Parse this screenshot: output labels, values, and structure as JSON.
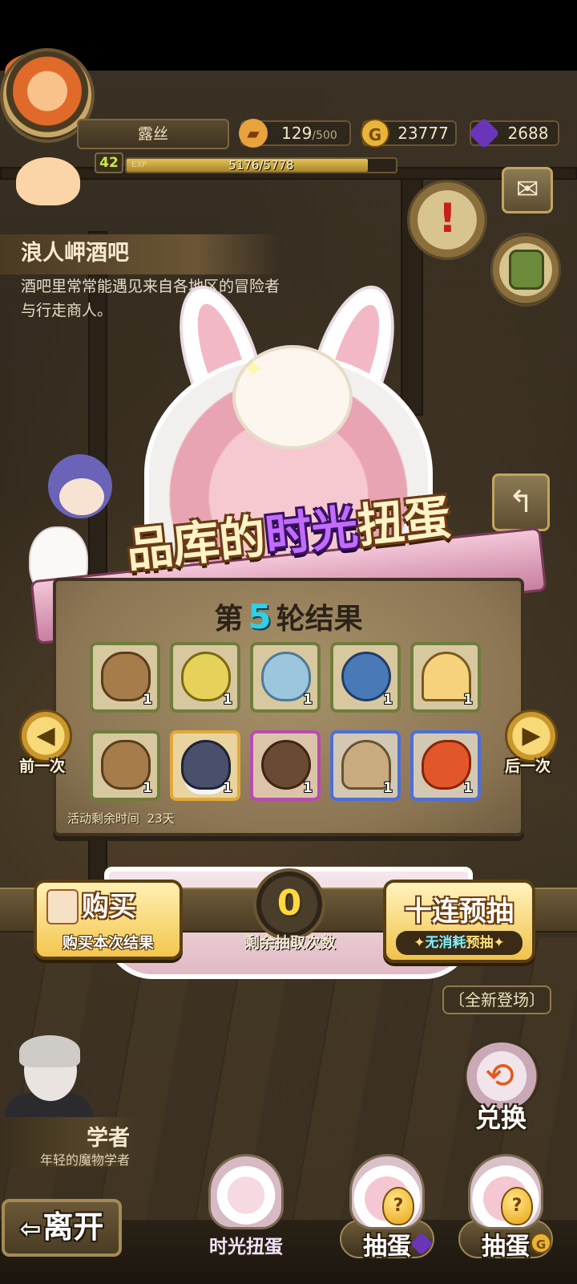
{
  "player": {
    "name": "露丝",
    "level": "42",
    "exp_label": "EXP",
    "exp_text": "5176/5778",
    "exp_progress": 0.896
  },
  "resources": {
    "stamina": {
      "icon": "bread-icon",
      "value": "129",
      "max": "/500"
    },
    "gold": {
      "icon": "gold-coin-icon",
      "glyph": "G",
      "value": "23777"
    },
    "gems": {
      "icon": "purple-gem-icon",
      "value": "2688"
    }
  },
  "location": {
    "title": "浪人岬酒吧",
    "description": "酒吧里常常能遇见来自各地区的冒险者与行走商人。"
  },
  "gacha": {
    "title_part1": "品库的",
    "title_highlight": "时光",
    "title_part2": "扭蛋",
    "round_prefix": "第",
    "round_number": "5",
    "round_suffix": "轮结果",
    "time_left_label": "活动剩余时间",
    "time_left_value": "23天",
    "prev_label": "前一次",
    "next_label": "后一次",
    "items": [
      {
        "name": "wooden-barrel-icon",
        "count": "1",
        "rarity": "green",
        "color": "#a57c4a"
      },
      {
        "name": "golden-egg-nest-icon",
        "count": "1",
        "rarity": "green",
        "color": "#e6d25a"
      },
      {
        "name": "blue-vase-icon",
        "count": "1",
        "rarity": "green",
        "color": "#9cc6de"
      },
      {
        "name": "blue-sprout-icon",
        "count": "1",
        "rarity": "green",
        "color": "#4a79b8"
      },
      {
        "name": "jelly-dome-icon",
        "count": "1",
        "rarity": "green",
        "color": "#f6d27c"
      },
      {
        "name": "wooden-barrel-icon",
        "count": "1",
        "rarity": "green",
        "color": "#a57c4a"
      },
      {
        "name": "blue-bird-cloud-icon",
        "count": "1",
        "rarity": "gold",
        "color": "#4a4f6b"
      },
      {
        "name": "teddy-bear-icon",
        "count": "1",
        "rarity": "purple",
        "color": "#6a4a32"
      },
      {
        "name": "feather-hat-icon",
        "count": "1",
        "rarity": "blue",
        "color": "#c9ab80"
      },
      {
        "name": "flame-swirl-icon",
        "count": "1",
        "rarity": "blue",
        "color": "#e2572a"
      }
    ]
  },
  "actions": {
    "buy_label": "购买",
    "buy_sub": "购买本次结果",
    "remaining_draws": "0",
    "remaining_label": "剩余抽取次数",
    "ten_label": "十连预抽",
    "ten_sub_free": "无消耗",
    "ten_sub_rest": "预抽",
    "new_badge": "全新登场"
  },
  "npc": {
    "name": "学者",
    "description": "年轻的魔物学者"
  },
  "exchange_label": "兑换",
  "leave_label": "离开",
  "tabs": [
    {
      "label": "时光扭蛋",
      "currency": ""
    },
    {
      "label": "抽蛋",
      "currency": "purple-gem-icon"
    },
    {
      "label": "抽蛋",
      "currency": "gold-coin-icon",
      "glyph": "G"
    }
  ],
  "colors": {
    "accent_gold": "#f3c64e",
    "highlight_purple": "#c16cff",
    "round_number": "#2fd0e8",
    "rarity_green": "#6f7d3c",
    "rarity_gold": "#e0a93a",
    "rarity_purple": "#b64db0",
    "rarity_blue": "#4d6fd6"
  }
}
